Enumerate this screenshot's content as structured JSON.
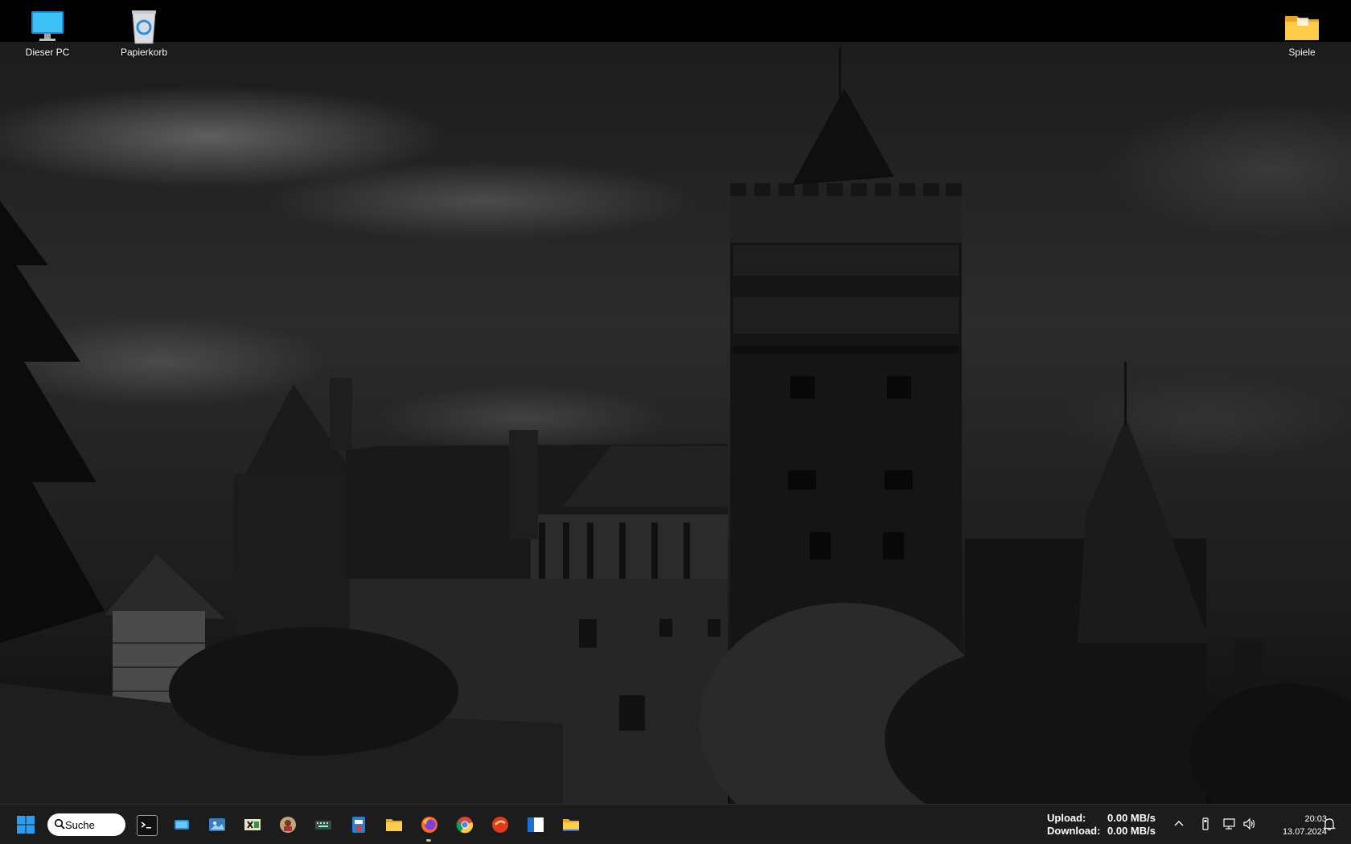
{
  "desktop": {
    "icons": [
      {
        "label": "Dieser PC",
        "icon": "monitor-icon"
      },
      {
        "label": "Papierkorb",
        "icon": "recycle-bin-icon"
      },
      {
        "label": "Spiele",
        "icon": "folder-icon"
      }
    ]
  },
  "taskbar": {
    "search_label": "Suche",
    "apps": [
      {
        "name": "terminal",
        "icon": "terminal-icon"
      },
      {
        "name": "taskbar-app-2",
        "icon": "blue-window-icon"
      },
      {
        "name": "taskbar-app-3",
        "icon": "image-viewer-icon"
      },
      {
        "name": "taskbar-app-4",
        "icon": "archive-icon"
      },
      {
        "name": "taskbar-app-5",
        "icon": "photo-app-icon"
      },
      {
        "name": "taskbar-app-6",
        "icon": "keyboard-icon"
      },
      {
        "name": "taskbar-app-7",
        "icon": "id-app-icon"
      },
      {
        "name": "file-explorer",
        "icon": "folder-icon"
      },
      {
        "name": "firefox",
        "icon": "firefox-icon"
      },
      {
        "name": "chrome",
        "icon": "chrome-icon"
      },
      {
        "name": "taskbar-app-11",
        "icon": "red-circle-app-icon"
      },
      {
        "name": "taskbar-app-12",
        "icon": "window-app-icon"
      },
      {
        "name": "taskbar-app-13",
        "icon": "folder-icon"
      }
    ],
    "netspeed": {
      "upload_label": "Upload:",
      "upload_value": "0.00 MB/s",
      "download_label": "Download:",
      "download_value": "0.00 MB/s"
    },
    "clock": {
      "time": "20:03",
      "date": "13.07.2024"
    },
    "tray_icons": [
      "chevron-up-icon",
      "usb-icon",
      "network-icon",
      "volume-icon",
      "notification-bell-icon"
    ],
    "colors": {
      "taskbar_bg": "#1c1c1c",
      "start_blue": "#2e9cf0"
    }
  }
}
